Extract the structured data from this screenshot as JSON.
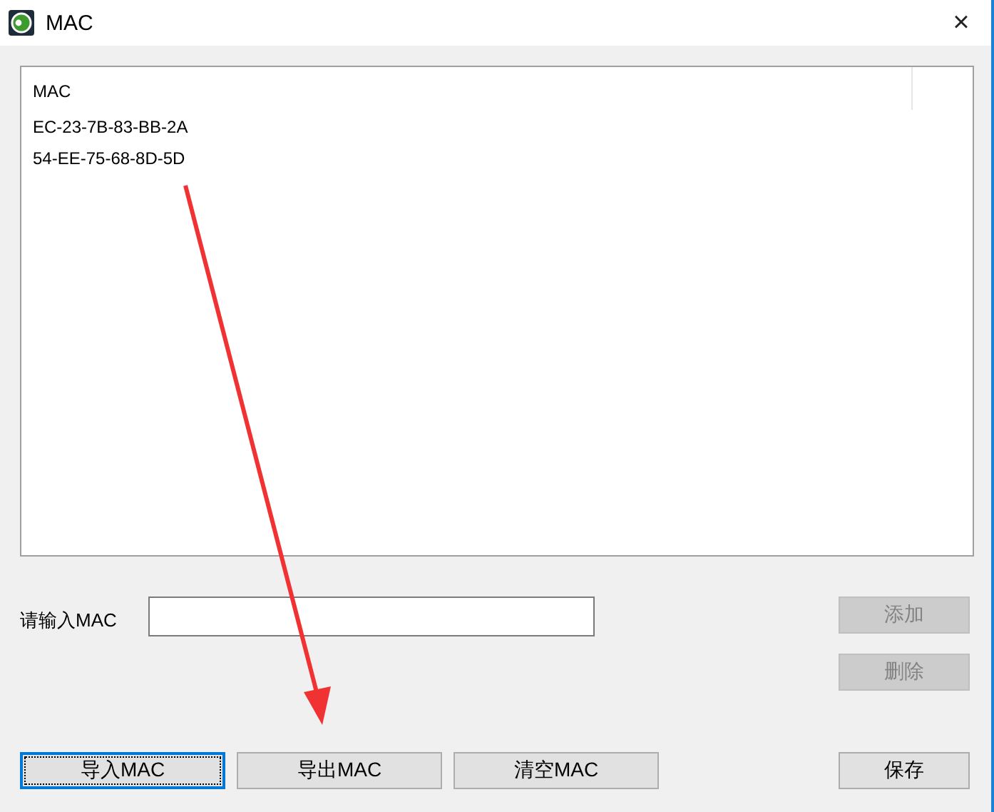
{
  "window": {
    "title": "MAC",
    "close": "×"
  },
  "list": {
    "columns": [
      "MAC"
    ],
    "rows": [
      "EC-23-7B-83-BB-2A",
      "54-EE-75-68-8D-5D"
    ]
  },
  "input": {
    "label": "请输入MAC"
  },
  "side_buttons": [
    {
      "label": "添加",
      "disabled": true
    },
    {
      "label": "删除",
      "disabled": true
    }
  ],
  "bottom_buttons": [
    {
      "label": "导入MAC",
      "focused": true
    },
    {
      "label": "导出MAC",
      "focused": false
    },
    {
      "label": "清空MAC",
      "focused": false
    }
  ],
  "save_button": {
    "label": "保存",
    "focused": false
  }
}
